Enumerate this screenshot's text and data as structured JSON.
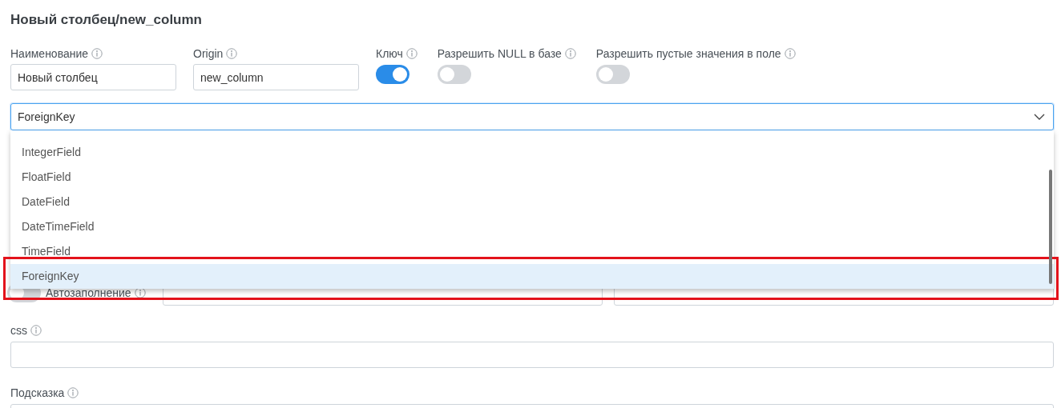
{
  "title": "Новый столбец/new_column",
  "fields": [
    {
      "label": "Наименование",
      "value": "Новый столбец"
    },
    {
      "label": "Origin",
      "value": "new_column"
    }
  ],
  "switches": [
    {
      "label": "Ключ",
      "on": true
    },
    {
      "label": "Разрешить NULL в базе",
      "on": false
    },
    {
      "label": "Разрешить пустые значения в поле",
      "on": false
    }
  ],
  "type_select": {
    "value": "ForeignKey",
    "expanded": true,
    "options": [
      {
        "label": "IntegerField",
        "selected": false,
        "highlighted": false
      },
      {
        "label": "FloatField",
        "selected": false,
        "highlighted": false
      },
      {
        "label": "DateField",
        "selected": false,
        "highlighted": false
      },
      {
        "label": "DateTimeField",
        "selected": false,
        "highlighted": false
      },
      {
        "label": "TimeField",
        "selected": false,
        "highlighted": false
      },
      {
        "label": "ForeignKey",
        "selected": true,
        "highlighted": true
      }
    ]
  },
  "autofill": {
    "label": "Автозаполнение",
    "on": false
  },
  "css_field": {
    "label": "css"
  },
  "hint_field": {
    "label": "Подсказка"
  }
}
